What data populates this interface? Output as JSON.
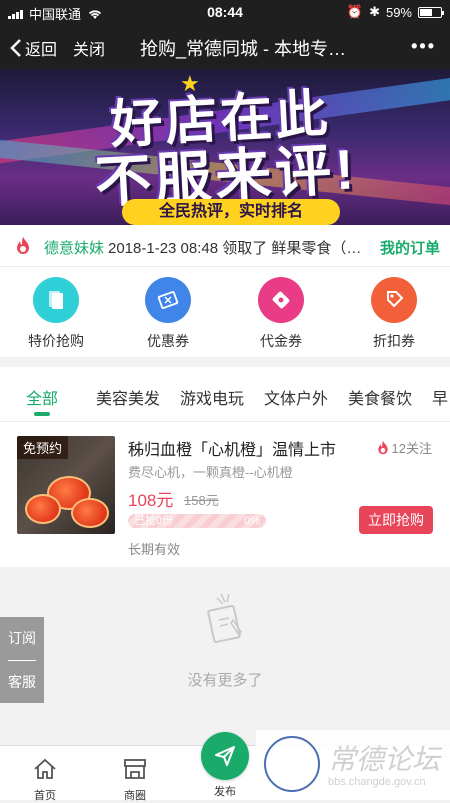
{
  "status": {
    "carrier": "中国联通",
    "time": "08:44",
    "battery": "59%",
    "battery_level": 0.59
  },
  "nav": {
    "back": "返回",
    "close": "关闭",
    "title": "抢购_常德同城 - 本地专…",
    "more": "•••"
  },
  "banner": {
    "line1": "好店在此",
    "line2": "不服来评!",
    "slogan": "全民热评，实时排名"
  },
  "ticker": {
    "user": "德意妹妹",
    "message": "2018-1-23 08:48 领取了 鲜果零食（…",
    "orders_link": "我的订单"
  },
  "categories": [
    {
      "label": "特价抢购",
      "icon": "special-offer-icon",
      "color": "#2ecfd6"
    },
    {
      "label": "优惠券",
      "icon": "coupon-icon",
      "color": "#3f86e8"
    },
    {
      "label": "代金券",
      "icon": "voucher-icon",
      "color": "#ea3c86"
    },
    {
      "label": "折扣券",
      "icon": "discount-icon",
      "color": "#f2603a"
    }
  ],
  "tabs": [
    "全部",
    "美容美发",
    "游戏电玩",
    "文体户外",
    "美食餐饮",
    "早…"
  ],
  "product": {
    "badge": "免预约",
    "title": "秭归血橙「心机橙」温情上市",
    "follow": "12关注",
    "desc": "费尽心机，一颗真橙--心机橙",
    "price": "108元",
    "original_price": "158元",
    "sold_label": "已抢0份",
    "progress_percent": "0%",
    "buy_label": "立即抢购",
    "validity": "长期有效"
  },
  "empty_text": "没有更多了",
  "side": {
    "subscribe": "订阅",
    "service": "客服"
  },
  "bottom": {
    "home": "首页",
    "store": "商圈",
    "publish": "发布"
  },
  "watermark": {
    "name": "常德论坛",
    "url": "bbs.changde.gov.cn"
  },
  "colors": {
    "accent": "#1aab6b",
    "price": "#e8445a"
  }
}
